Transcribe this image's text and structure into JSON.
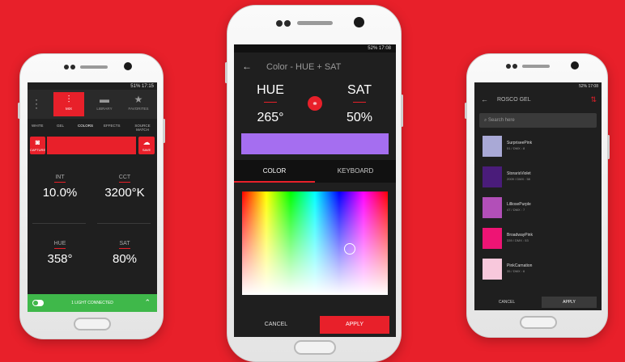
{
  "colors": {
    "background": "#e8202a",
    "accent": "#e8202a",
    "connected": "#3fb84a",
    "selected_color": "#a56ef0"
  },
  "phone_mix": {
    "status": "51% 17:15",
    "menu_icon": "more-vertical-icon",
    "tabs": [
      {
        "label": "MIX",
        "icon": "sliders-icon"
      },
      {
        "label": "LIBRARY",
        "icon": "folder-icon"
      },
      {
        "label": "FAVORITES",
        "icon": "star-icon"
      }
    ],
    "subtabs": [
      "WHITE",
      "GEL",
      "COLORS",
      "EFFECTS",
      "SOURCE MATCH"
    ],
    "capture_label": "CAPTURE",
    "save_label": "SAVE",
    "int": {
      "label": "INT",
      "value": "10.0%"
    },
    "cct": {
      "label": "CCT",
      "value": "3200°K"
    },
    "hue": {
      "label": "HUE",
      "value": "358°"
    },
    "sat": {
      "label": "SAT",
      "value": "80%"
    },
    "connection": "1 LIGHT CONNECTED"
  },
  "phone_hue": {
    "status": "52% 17:08",
    "title": "Color - HUE + SAT",
    "hue_label": "HUE",
    "sat_label": "SAT",
    "hue_value": "265°",
    "sat_value": "50%",
    "tabs": [
      "COLOR",
      "KEYBOARD"
    ],
    "cancel": "CANCEL",
    "apply": "APPLY"
  },
  "phone_gel": {
    "status": "52% 17:08",
    "title": "ROSCO GEL",
    "search_placeholder": "Search here",
    "gels": [
      {
        "name": "SurpriseePink",
        "code": "51 / DMX : 8",
        "color": "#a9a9d6"
      },
      {
        "name": "StorarisViolet",
        "code": "2009 / DMX : 58",
        "color": "#4a1c7a"
      },
      {
        "name": "LilliosePurple",
        "code": "47 / DMX : 7",
        "color": "#b24fb8"
      },
      {
        "name": "BroadwayPink",
        "code": "339 / DMX : 53",
        "color": "#ee1474"
      },
      {
        "name": "PinkCarnation",
        "code": "35 / DMX : 6",
        "color": "#f8c8dc"
      }
    ],
    "cancel": "CANCEL",
    "apply": "APPLY"
  }
}
